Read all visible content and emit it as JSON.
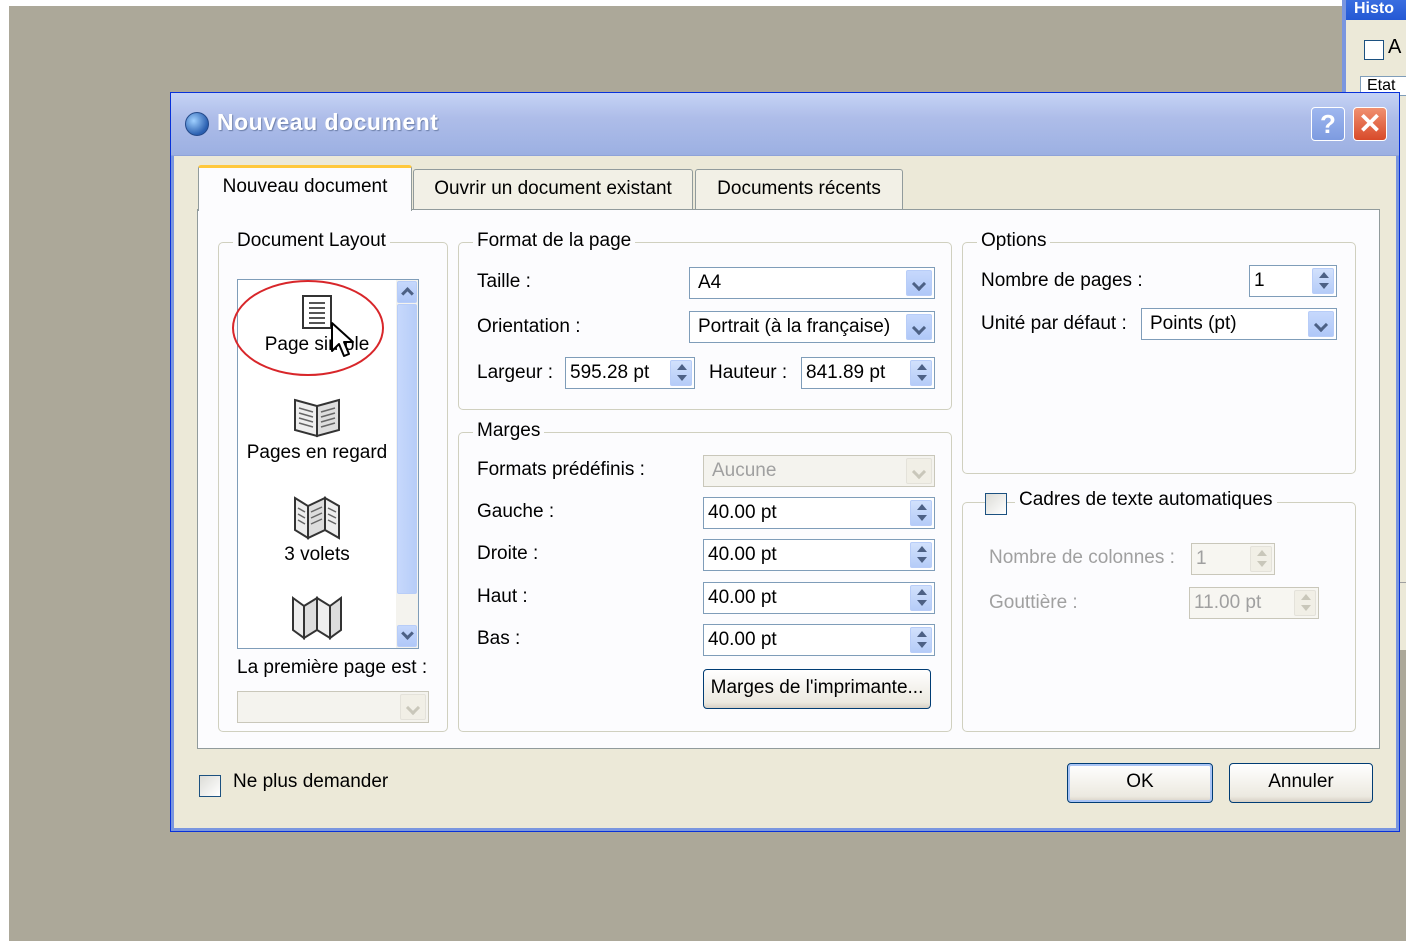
{
  "background_window": {
    "title": "Histo",
    "checkbox_label": "A",
    "field_text": "Etat"
  },
  "dialog": {
    "title": "Nouveau document",
    "help_glyph": "?",
    "close_glyph": "✕"
  },
  "tabs": [
    {
      "label": "Nouveau document",
      "active": true
    },
    {
      "label": "Ouvrir un document existant",
      "active": false
    },
    {
      "label": "Documents récents",
      "active": false
    }
  ],
  "layout_group": {
    "title": "Document Layout",
    "items": [
      {
        "label": "Page simple",
        "icon": "single-page-icon",
        "selected": true
      },
      {
        "label": "Pages en regard",
        "icon": "facing-pages-icon",
        "selected": false
      },
      {
        "label": "3 volets",
        "icon": "three-fold-icon",
        "selected": false
      },
      {
        "label": "",
        "icon": "four-fold-icon",
        "selected": false
      }
    ],
    "first_page_label": "La première page est :",
    "first_page_value": ""
  },
  "page_format": {
    "title": "Format de la page",
    "size_label": "Taille :",
    "size_value": "A4",
    "orientation_label": "Orientation :",
    "orientation_value": "Portrait (à la française)",
    "width_label": "Largeur :",
    "width_value": "595.28 pt",
    "height_label": "Hauteur :",
    "height_value": "841.89 pt"
  },
  "margins": {
    "title": "Marges",
    "presets_label": "Formats prédéfinis :",
    "presets_value": "Aucune",
    "left_label": "Gauche :",
    "left_value": "40.00 pt",
    "right_label": "Droite :",
    "right_value": "40.00 pt",
    "top_label": "Haut :",
    "top_value": "40.00 pt",
    "bottom_label": "Bas :",
    "bottom_value": "40.00 pt",
    "printer_margins_label": "Marges de l'imprimante..."
  },
  "options": {
    "title": "Options",
    "pages_label": "Nombre de pages :",
    "pages_value": "1",
    "unit_label": "Unité par défaut :",
    "unit_value": "Points (pt)"
  },
  "text_frames": {
    "title": "Cadres de texte automatiques",
    "checked": false,
    "columns_label": "Nombre de colonnes :",
    "columns_value": "1",
    "gutter_label": "Gouttière :",
    "gutter_value": "11.00 pt"
  },
  "footer": {
    "dont_ask_label": "Ne plus demander",
    "ok_label": "OK",
    "cancel_label": "Annuler"
  },
  "colors": {
    "desktop": "#aca899",
    "dialog_face": "#ece9d8",
    "titlebar": "#aebde9",
    "highlight_circle": "#d8262a",
    "active_tab_accent": "#ffc83c"
  }
}
